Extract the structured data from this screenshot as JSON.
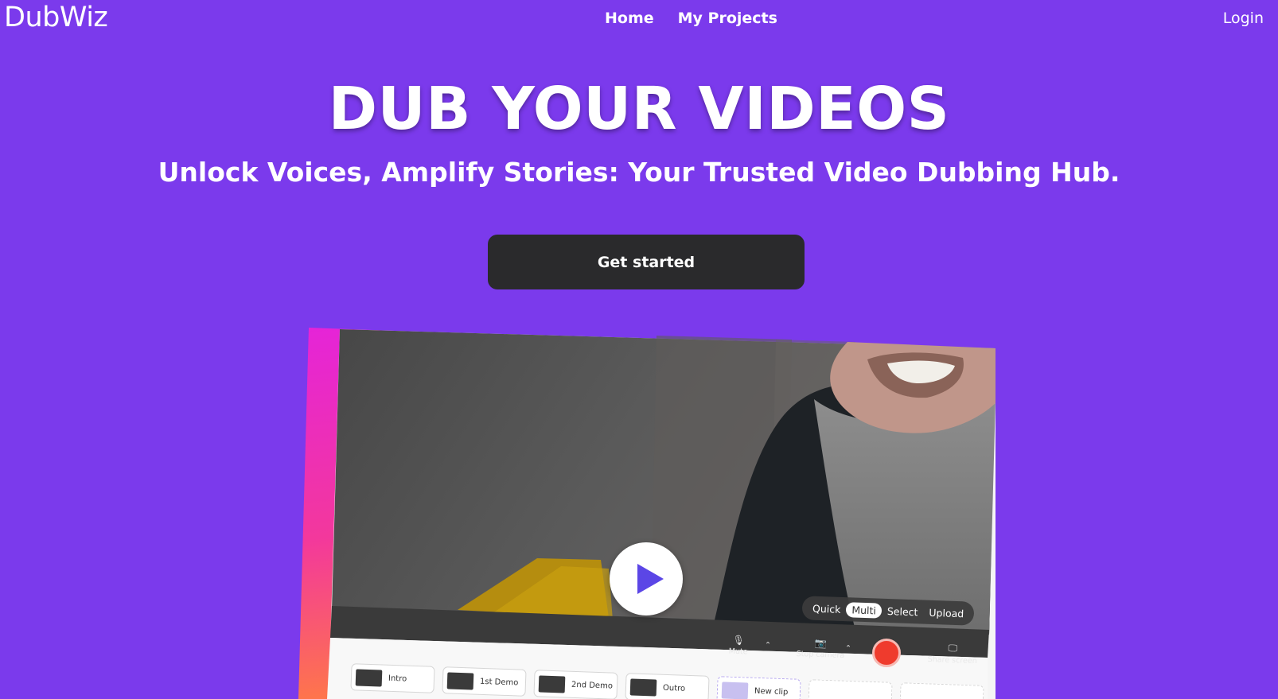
{
  "nav": {
    "brand": "DubWiz",
    "links": [
      "Home",
      "My Projects"
    ],
    "login": "Login"
  },
  "hero": {
    "title": "DUB YOUR VIDEOS",
    "subtitle": "Unlock Voices, Amplify Stories: Your Trusted Video Dubbing Hub.",
    "cta": "Get started"
  },
  "preview": {
    "modes": [
      "Quick",
      "Multi",
      "Select",
      "Upload"
    ],
    "active_mode": "Multi",
    "controls": {
      "mute": "Mute",
      "stop_camera": "Stop camera",
      "share_screen": "Share screen"
    },
    "clips": [
      "Intro",
      "1st Demo",
      "2nd Demo",
      "Outro"
    ],
    "new_clip": "New clip"
  },
  "colors": {
    "background": "#7b3aec",
    "cta_background": "#2a2a2c",
    "record": "#ef3b2d",
    "play_icon": "#5b46e6"
  }
}
